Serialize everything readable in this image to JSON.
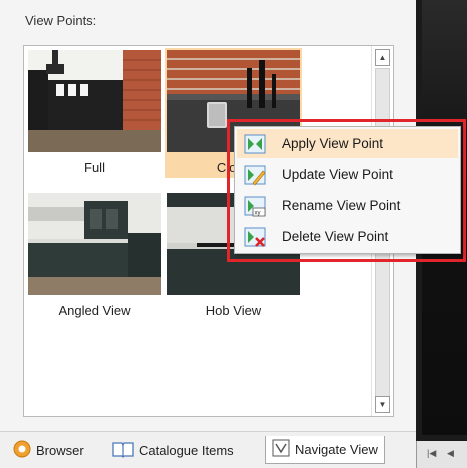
{
  "panel": {
    "label": "View Points:"
  },
  "viewpoints": [
    {
      "label": "Full"
    },
    {
      "label": "Close"
    },
    {
      "label": "Angled View"
    },
    {
      "label": "Hob View"
    }
  ],
  "context_menu": {
    "items": [
      {
        "label": "Apply View Point"
      },
      {
        "label": "Update View Point"
      },
      {
        "label": "Rename View Point"
      },
      {
        "label": "Delete View Point"
      }
    ]
  },
  "tabs": [
    {
      "label": "Browser"
    },
    {
      "label": "Catalogue Items"
    },
    {
      "label": "Navigate View"
    }
  ],
  "colors": {
    "selected_tile": "#fbd8a8",
    "menu_hover": "#fde5c8",
    "highlight_outline": "#e0262b"
  }
}
